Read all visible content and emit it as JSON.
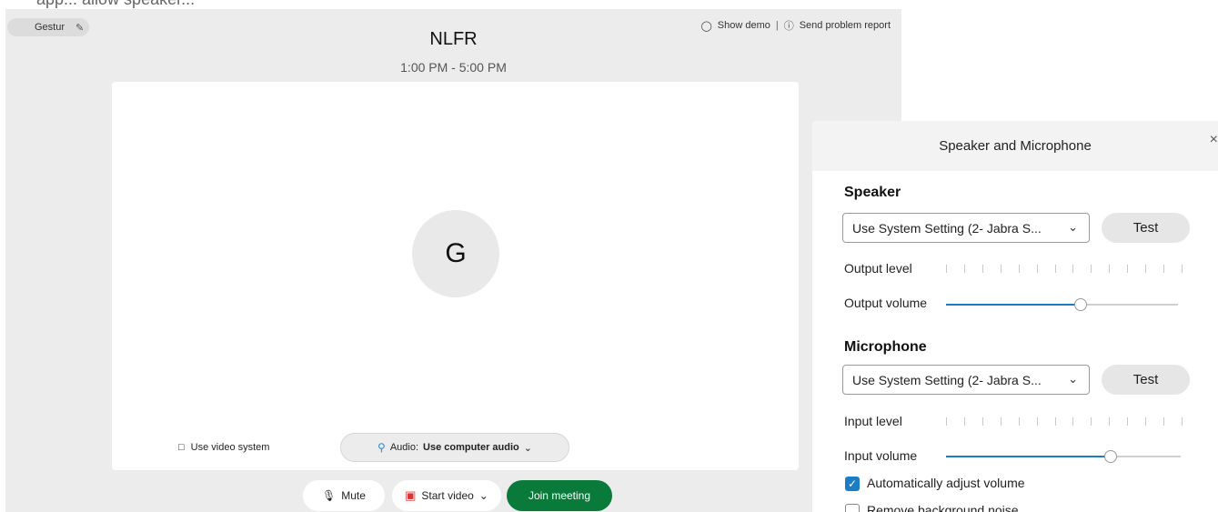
{
  "top_strip_text": "app... allow speaker...",
  "meeting": {
    "name_pill": "Gestur",
    "help": {
      "show_demo": "Show demo",
      "separator": "|",
      "report": "Send problem report"
    },
    "title": "NLFR",
    "time": "1:00 PM - 5:00 PM",
    "avatar_initial": "G",
    "use_video_system": "Use video system",
    "audio_prefix": "Audio:",
    "audio_value": "Use computer audio",
    "mute_label": "Mute",
    "start_video_label": "Start video",
    "join_label": "Join meeting"
  },
  "panel": {
    "title": "Speaker and Microphone",
    "close": "×",
    "speaker": {
      "heading": "Speaker",
      "select_value": "Use System Setting (2- Jabra S...",
      "test_label": "Test",
      "level_label": "Output level",
      "volume_label": "Output volume",
      "volume_fraction": 0.58
    },
    "microphone": {
      "heading": "Microphone",
      "select_value": "Use System Setting (2- Jabra S...",
      "test_label": "Test",
      "level_label": "Input level",
      "volume_label": "Input volume",
      "volume_fraction": 0.7
    },
    "auto_adjust_label": "Automatically adjust volume",
    "auto_adjust_checked": true,
    "remove_noise_label": "Remove background noise",
    "remove_noise_checked": false
  }
}
